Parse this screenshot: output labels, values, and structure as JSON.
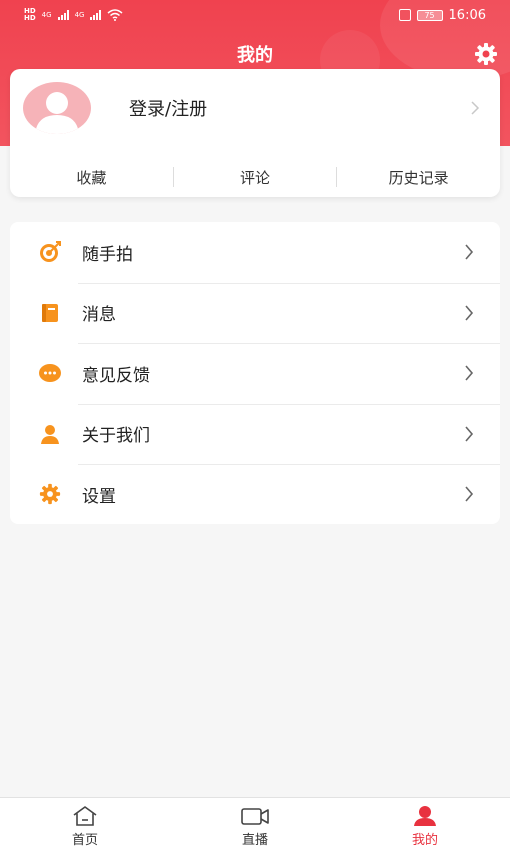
{
  "status_bar": {
    "network_1": "4G",
    "network_2": "4G",
    "battery": "75",
    "time": "16:06"
  },
  "header": {
    "title": "我的"
  },
  "profile": {
    "login_label": "登录/注册"
  },
  "quick_tabs": [
    {
      "label": "收藏"
    },
    {
      "label": "评论"
    },
    {
      "label": "历史记录"
    }
  ],
  "menu": [
    {
      "label": "随手拍",
      "icon": "target-icon"
    },
    {
      "label": "消息",
      "icon": "message-book-icon"
    },
    {
      "label": "意见反馈",
      "icon": "feedback-bubble-icon"
    },
    {
      "label": "关于我们",
      "icon": "person-icon"
    },
    {
      "label": "设置",
      "icon": "gear-icon"
    }
  ],
  "bottom_nav": [
    {
      "label": "首页",
      "icon": "home-icon",
      "active": false
    },
    {
      "label": "直播",
      "icon": "video-camera-icon",
      "active": false
    },
    {
      "label": "我的",
      "icon": "profile-icon",
      "active": true
    }
  ],
  "colors": {
    "brand_red": "#f0424f",
    "icon_orange": "#f7931e",
    "active_red": "#e8323f"
  }
}
